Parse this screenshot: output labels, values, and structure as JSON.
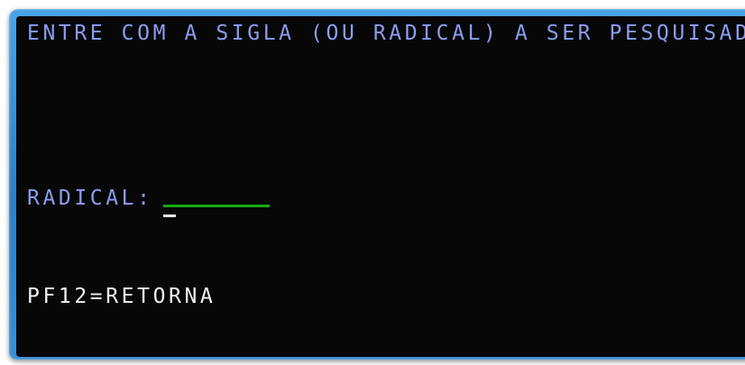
{
  "screen": {
    "prompt_text": "ENTRE COM A SIGLA (OU RADICAL) A SER PESQUISADA",
    "radical_label": "RADICAL:",
    "radical_value": "",
    "pf_key_hint": "PF12=RETORNA"
  },
  "colors": {
    "background": "#070707",
    "prompt": "#8c9cf0",
    "input_underline": "#18a818",
    "hint": "#f2f2f2",
    "frame": "#2d7fc6"
  }
}
